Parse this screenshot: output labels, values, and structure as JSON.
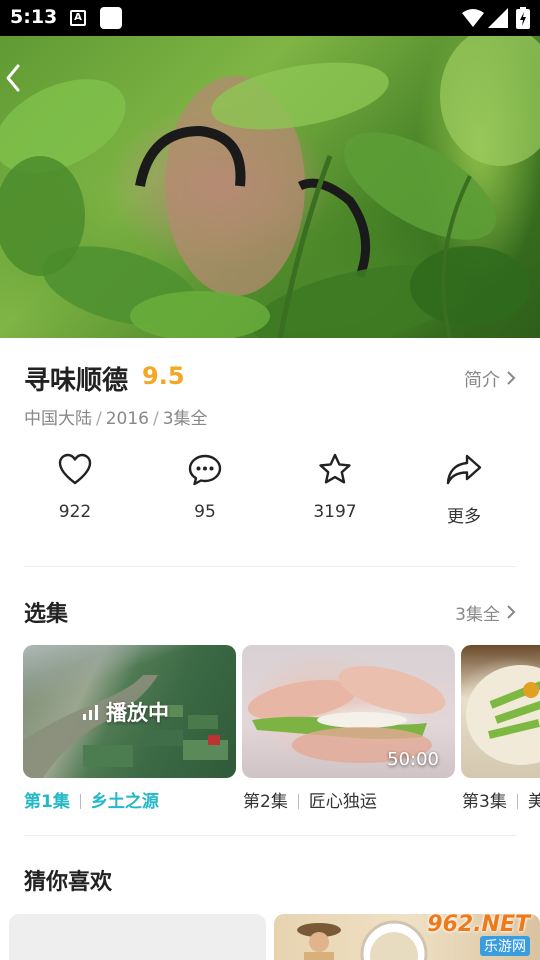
{
  "status_bar": {
    "time": "5:13",
    "a_icon": "A"
  },
  "show": {
    "title": "寻味顺德",
    "score": "9.5",
    "intro_label": "简介",
    "region": "中国大陆",
    "year": "2016",
    "episodes_total": "3集全",
    "separator": "/"
  },
  "actions": [
    {
      "icon": "heart-icon",
      "label": "922"
    },
    {
      "icon": "comment-icon",
      "label": "95"
    },
    {
      "icon": "star-icon",
      "label": "3197"
    },
    {
      "icon": "share-icon",
      "label": "更多"
    }
  ],
  "episodes_section": {
    "title": "选集",
    "more_label": "3集全",
    "items": [
      {
        "num": "第1集",
        "name": "乡土之源",
        "badge": "播放中"
      },
      {
        "num": "第2集",
        "name": "匠心独运",
        "duration": "50:00"
      },
      {
        "num": "第3集",
        "name": "美"
      }
    ]
  },
  "recommend_section": {
    "title": "猜你喜欢"
  },
  "watermark": {
    "main": "962.NET",
    "sub": "乐游网"
  },
  "colors": {
    "accent": "#22b8c8",
    "score": "#f5a623"
  }
}
